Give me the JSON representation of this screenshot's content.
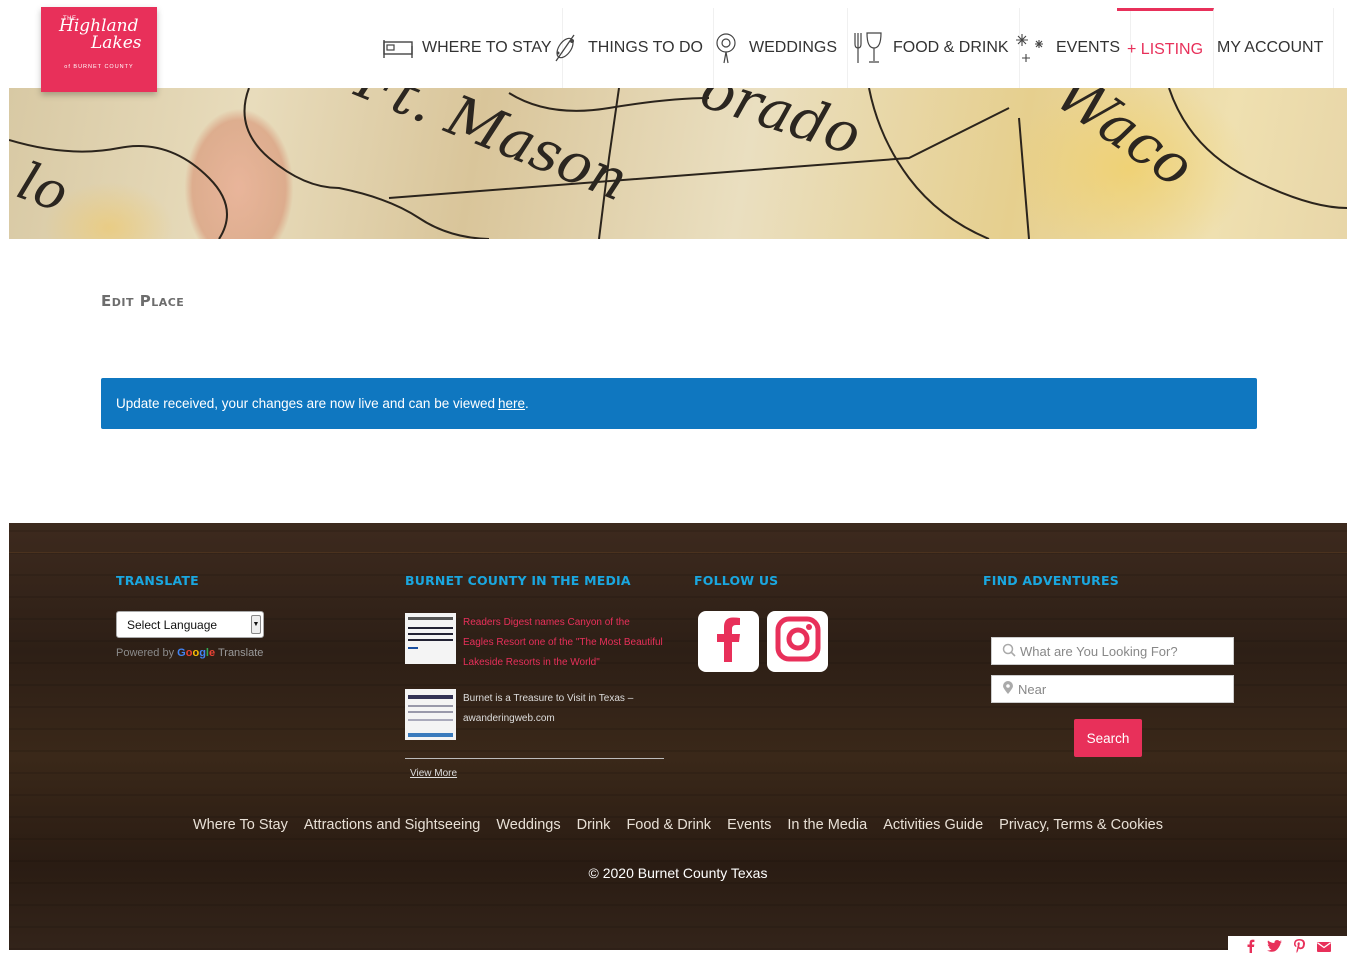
{
  "logo": {
    "the": "THE",
    "line1": "Highland",
    "line2": "Lakes",
    "sub": "of BURNET COUNTY"
  },
  "nav": [
    {
      "label": "WHERE TO STAY",
      "icon": "bed-icon"
    },
    {
      "label": "THINGS TO DO",
      "icon": "leaf-icon"
    },
    {
      "label": "WEDDINGS",
      "icon": "flower-icon"
    },
    {
      "label": "FOOD & DRINK",
      "icon": "fork-glass-icon"
    },
    {
      "label": "EVENTS",
      "icon": "fireworks-icon"
    },
    {
      "label": "+ LISTING",
      "active": true
    },
    {
      "label": "MY ACCOUNT"
    }
  ],
  "banner": {
    "words": [
      "Ft. Mason",
      "orado",
      "Waco",
      "lo"
    ]
  },
  "content": {
    "title": "Edit Place",
    "notice": "Update received, your changes are now live and can be viewed",
    "notice_link": "here"
  },
  "footer": {
    "translate": {
      "heading": "TRANSLATE",
      "select": "Select Language",
      "powered_by": "Powered by",
      "google": "Google",
      "translate_word": "Translate"
    },
    "media": {
      "heading": "BURNET COUNTY IN THE MEDIA",
      "items": [
        "Readers Digest names Canyon of the Eagles Resort one of the \"The Most Beautiful Lakeside Resorts in the World\"",
        "Burnet is a Treasure to Visit in Texas – awanderingweb.com"
      ],
      "view_more": "View More"
    },
    "follow": {
      "heading": "FOLLOW US"
    },
    "find": {
      "heading": "FIND ADVENTURES",
      "search_placeholder": "What are You Looking For?",
      "near_placeholder": "Near",
      "search_button": "Search"
    },
    "links": [
      "Where To Stay",
      "Attractions and Sightseeing",
      "Weddings",
      "Drink",
      "Food & Drink",
      "Events",
      "In the Media",
      "Activities Guide",
      "Privacy, Terms & Cookies"
    ],
    "copyright": "© 2020 Burnet County Texas"
  },
  "colors": {
    "brand_pink": "#e8305a",
    "notice_blue": "#0f77c0",
    "heading_blue": "#1aa7e0"
  }
}
